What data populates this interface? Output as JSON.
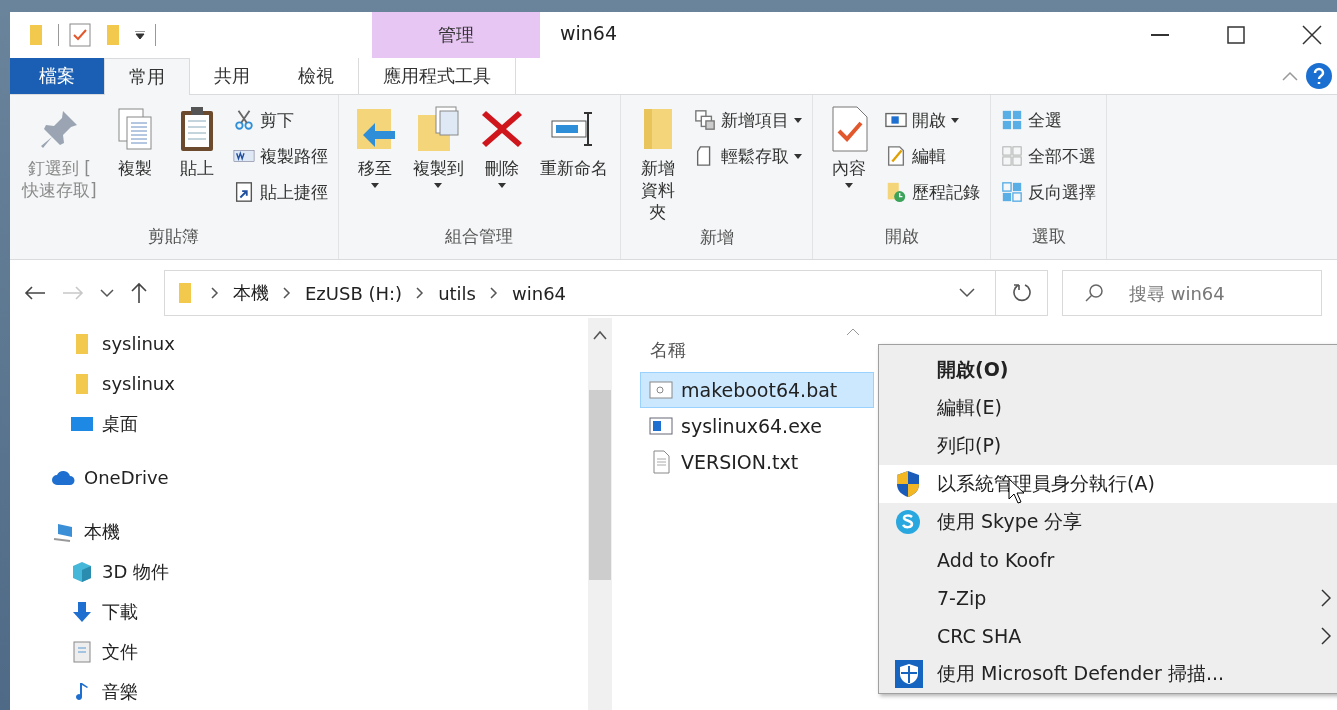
{
  "window": {
    "title": "win64",
    "context_tab_group": "管理"
  },
  "ribbon_tabs": [
    {
      "label": "檔案",
      "kind": "file",
      "selected": false
    },
    {
      "label": "常用",
      "kind": "tab",
      "selected": true
    },
    {
      "label": "共用",
      "kind": "tab",
      "selected": false
    },
    {
      "label": "檢視",
      "kind": "tab",
      "selected": false
    },
    {
      "label": "應用程式工具",
      "kind": "context",
      "selected": false
    }
  ],
  "ribbon_groups": [
    {
      "title": "剪貼簿",
      "items": [
        {
          "label": "釘選到 [\n快速存取]",
          "kind": "large",
          "disabled": true,
          "dropdown": false
        },
        {
          "label": "複製",
          "kind": "large",
          "disabled": false,
          "dropdown": false
        },
        {
          "label": "貼上",
          "kind": "large",
          "disabled": false,
          "dropdown": false
        },
        {
          "label": "剪下",
          "kind": "small",
          "disabled": false,
          "dropdown": false
        },
        {
          "label": "複製路徑",
          "kind": "small",
          "disabled": false,
          "dropdown": false
        },
        {
          "label": "貼上捷徑",
          "kind": "small",
          "disabled": false,
          "dropdown": false
        }
      ]
    },
    {
      "title": "組合管理",
      "items": [
        {
          "label": "移至",
          "kind": "large",
          "disabled": false,
          "dropdown": true
        },
        {
          "label": "複製到",
          "kind": "large",
          "disabled": false,
          "dropdown": true
        },
        {
          "label": "刪除",
          "kind": "large",
          "disabled": false,
          "dropdown": true
        },
        {
          "label": "重新命名",
          "kind": "large",
          "disabled": false,
          "dropdown": false
        }
      ]
    },
    {
      "title": "新增",
      "items": [
        {
          "label": "新增資料夾",
          "kind": "large",
          "disabled": false,
          "dropdown": false
        },
        {
          "label": "新增項目",
          "kind": "small",
          "disabled": false,
          "dropdown": true
        },
        {
          "label": "輕鬆存取",
          "kind": "small",
          "disabled": false,
          "dropdown": true
        }
      ]
    },
    {
      "title": "開啟",
      "items": [
        {
          "label": "內容",
          "kind": "large",
          "disabled": false,
          "dropdown": true
        },
        {
          "label": "開啟",
          "kind": "small",
          "disabled": false,
          "dropdown": true
        },
        {
          "label": "編輯",
          "kind": "small",
          "disabled": false,
          "dropdown": false
        },
        {
          "label": "歷程記錄",
          "kind": "small",
          "disabled": false,
          "dropdown": false
        }
      ]
    },
    {
      "title": "選取",
      "items": [
        {
          "label": "全選",
          "kind": "small",
          "disabled": false,
          "dropdown": false
        },
        {
          "label": "全部不選",
          "kind": "small",
          "disabled": false,
          "dropdown": false
        },
        {
          "label": "反向選擇",
          "kind": "small",
          "disabled": false,
          "dropdown": false
        }
      ]
    }
  ],
  "navigation": {
    "back_disabled": false,
    "forward_disabled": true
  },
  "address_bar": {
    "breadcrumbs": [
      "本機",
      "EzUSB (H:)",
      "utils",
      "win64"
    ]
  },
  "search": {
    "placeholder": "搜尋 win64"
  },
  "nav_pane": {
    "items": [
      {
        "label": "syslinux",
        "kind": "folder",
        "top": false
      },
      {
        "label": "syslinux",
        "kind": "folder",
        "top": false
      },
      {
        "label": "桌面",
        "kind": "desktop",
        "top": false
      },
      {
        "label": "OneDrive",
        "kind": "cloud",
        "top": true
      },
      {
        "label": "本機",
        "kind": "pc",
        "top": true,
        "children": [
          {
            "label": "3D 物件",
            "kind": "cube"
          },
          {
            "label": "下載",
            "kind": "download"
          },
          {
            "label": "文件",
            "kind": "document"
          },
          {
            "label": "音樂",
            "kind": "music"
          }
        ]
      }
    ]
  },
  "file_list": {
    "columns": [
      "名稱"
    ],
    "files": [
      {
        "name": "makeboot64.bat",
        "kind": "bat",
        "selected": true
      },
      {
        "name": "syslinux64.exe",
        "kind": "exe",
        "selected": false
      },
      {
        "name": "VERSION.txt",
        "kind": "txt",
        "selected": false
      }
    ]
  },
  "context_menu": {
    "items": [
      {
        "label": "開啟(O)",
        "kind": "default",
        "submenu": false,
        "selected": false
      },
      {
        "label": "編輯(E)",
        "kind": "plain",
        "submenu": false,
        "selected": false
      },
      {
        "label": "列印(P)",
        "kind": "plain",
        "submenu": false,
        "selected": false
      },
      {
        "label": "以系統管理員身分執行(A)",
        "kind": "admin",
        "submenu": false,
        "selected": true
      },
      {
        "label": "使用 Skype 分享",
        "kind": "share",
        "submenu": false,
        "selected": false
      },
      {
        "label": "Add to Koofr",
        "kind": "plain",
        "submenu": false,
        "selected": false
      },
      {
        "label": "7-Zip",
        "kind": "plain",
        "submenu": true,
        "selected": false
      },
      {
        "label": "CRC SHA",
        "kind": "plain",
        "submenu": true,
        "selected": false
      },
      {
        "label": "使用 Microsoft Defender 掃描...",
        "kind": "scan",
        "submenu": false,
        "selected": false
      }
    ]
  }
}
